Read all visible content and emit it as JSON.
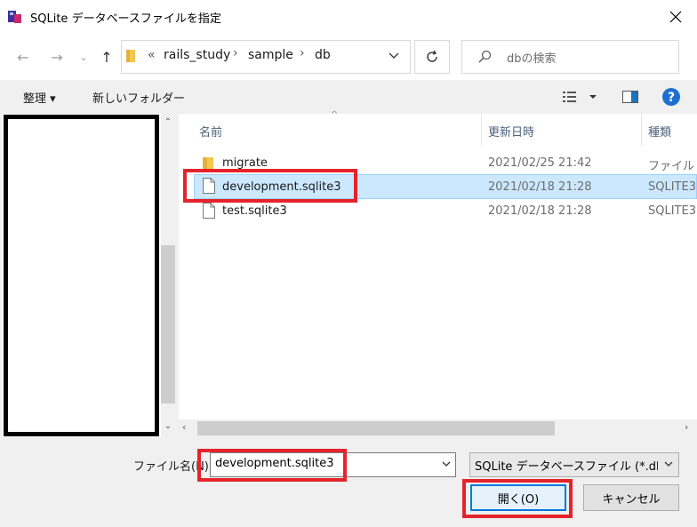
{
  "window": {
    "title": "SQLite データベースファイルを指定"
  },
  "address": {
    "overflow": "«",
    "crumbs": [
      "rails_study",
      "sample",
      "db"
    ]
  },
  "search": {
    "placeholder": "dbの検索"
  },
  "toolbar": {
    "organize": "整理 ▾",
    "new_folder": "新しいフォルダー"
  },
  "list": {
    "columns": {
      "name": "名前",
      "modified": "更新日時",
      "type": "種類"
    },
    "rows": [
      {
        "name": "migrate",
        "modified": "2021/02/25 21:42",
        "type": "ファイル フ",
        "icon": "folder-icon"
      },
      {
        "name": "development.sqlite3",
        "modified": "2021/02/18 21:28",
        "type": "SQLITE3",
        "icon": "file-icon",
        "selected": true
      },
      {
        "name": "test.sqlite3",
        "modified": "2021/02/18 21:28",
        "type": "SQLITE3",
        "icon": "file-icon"
      }
    ]
  },
  "bottom": {
    "filename_label": "ファイル名(N):",
    "filename_value": "development.sqlite3",
    "filetype_value": "SQLite データベースファイル (*.db;*.s",
    "open_label": "開く(O)",
    "cancel_label": "キャンセル"
  },
  "colors": {
    "highlight": "#e5232b",
    "selection": "#cce8ff",
    "accent": "#0078d7"
  }
}
